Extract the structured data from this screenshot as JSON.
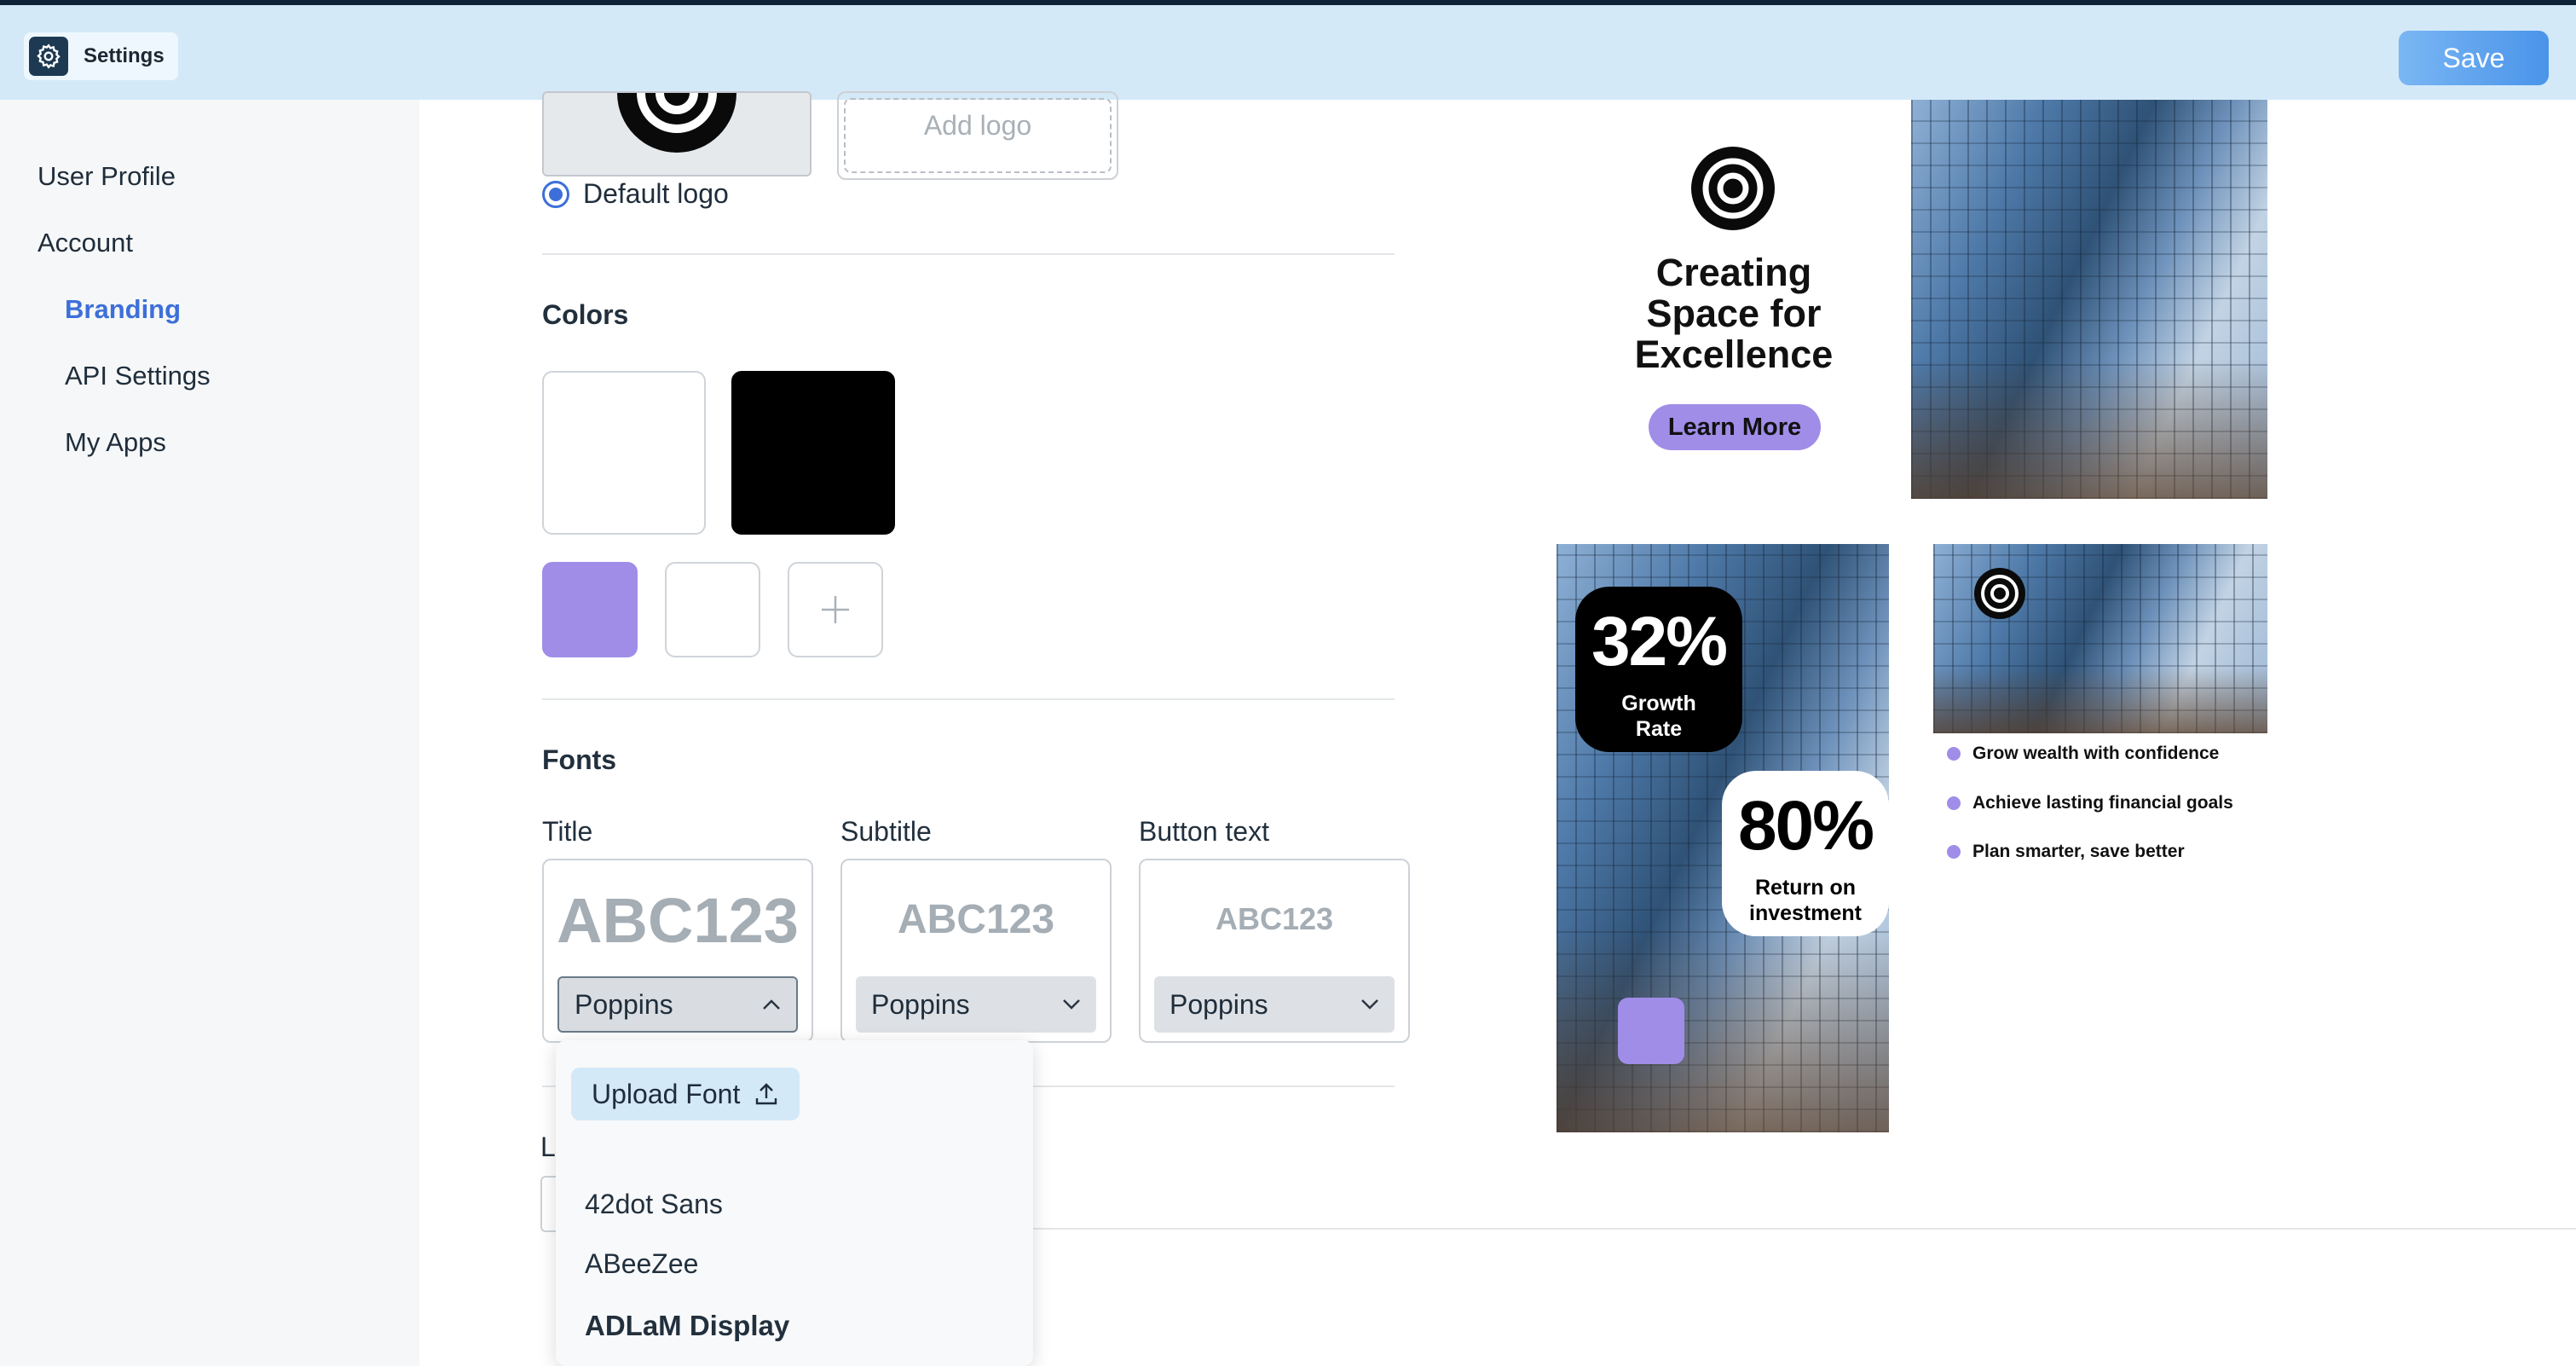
{
  "header": {
    "app_title": "Settings",
    "save_label": "Save",
    "icon": "gear-icon"
  },
  "sidebar": {
    "items": [
      {
        "label": "User Profile",
        "active": false
      },
      {
        "label": "Account",
        "active": false
      },
      {
        "label": "Branding",
        "active": true
      },
      {
        "label": "API Settings",
        "active": false
      },
      {
        "label": "My Apps",
        "active": false
      }
    ]
  },
  "logo": {
    "add_logo_label": "Add logo",
    "default_logo_label": "Default logo",
    "default_selected": true
  },
  "colors": {
    "title": "Colors",
    "primary": [
      "#ffffff",
      "#000000"
    ],
    "secondary": [
      "#a08de8",
      "#ffffff"
    ],
    "add_icon": "plus-icon"
  },
  "fonts": {
    "title": "Fonts",
    "groups": [
      {
        "label": "Title",
        "sample": "ABC123",
        "font": "Poppins",
        "open": true
      },
      {
        "label": "Subtitle",
        "sample": "ABC123",
        "font": "Poppins",
        "open": false
      },
      {
        "label": "Button text",
        "sample": "ABC123",
        "font": "Poppins",
        "open": false
      }
    ],
    "dropdown": {
      "upload_label": "Upload Font",
      "options": [
        "42dot Sans",
        "ABeeZee",
        "ADLaM Display"
      ]
    },
    "partial_next_label": "L"
  },
  "preview": {
    "hero_title": "Creating Space for Excellence",
    "cta_label": "Learn More",
    "stat1": {
      "value": "32%",
      "caption": "Growth Rate"
    },
    "stat2": {
      "value": "80%",
      "caption": "Return on investment"
    },
    "bullets": [
      "Grow wealth with confidence",
      "Achieve lasting financial goals",
      "Plan smarter, save better"
    ],
    "accent_color": "#a08de8"
  }
}
